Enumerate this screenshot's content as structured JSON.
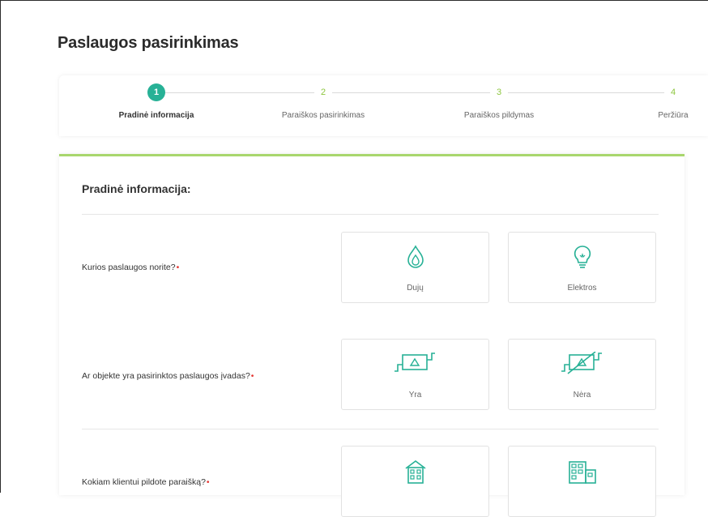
{
  "page": {
    "title": "Paslaugos pasirinkimas"
  },
  "stepper": {
    "steps": [
      {
        "number": "1",
        "label": "Pradinė informacija",
        "active": true
      },
      {
        "number": "2",
        "label": "Paraiškos pasirinkimas",
        "active": false
      },
      {
        "number": "3",
        "label": "Paraiškos pildymas",
        "active": false
      },
      {
        "number": "4",
        "label": "Peržiūra",
        "active": false
      }
    ]
  },
  "form": {
    "section_title": "Pradinė informacija:",
    "required_mark": "•",
    "questions": [
      {
        "label": "Kurios paslaugos norite?",
        "options": [
          {
            "label": "Dujų",
            "icon": "flame-icon"
          },
          {
            "label": "Elektros",
            "icon": "lightbulb-icon"
          }
        ]
      },
      {
        "label": "Ar objekte yra pasirinktos paslaugos įvadas?",
        "options": [
          {
            "label": "Yra",
            "icon": "meter-icon"
          },
          {
            "label": "Nėra",
            "icon": "meter-crossed-icon"
          }
        ]
      },
      {
        "label": "Kokiam klientui pildote paraišką?",
        "options": [
          {
            "label": "",
            "icon": "house-icon"
          },
          {
            "label": "",
            "icon": "office-building-icon"
          }
        ]
      }
    ]
  },
  "colors": {
    "accent": "#27b196",
    "step_number": "#8dc63f",
    "card_border": "#a8d66d",
    "required": "#e53935"
  }
}
